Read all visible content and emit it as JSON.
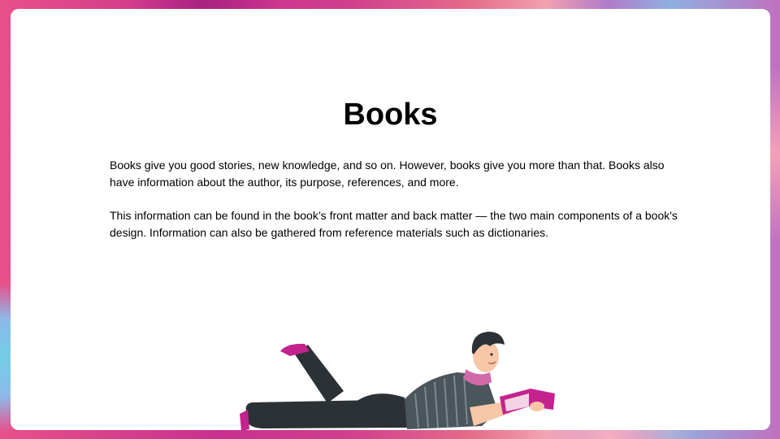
{
  "slide": {
    "title": "Books",
    "paragraphs": [
      "Books give you good stories, new knowledge, and so on. However, books give you more than that. Books also have information about the author, its purpose, references, and more.",
      "This information can be found in the book’s front matter and back matter — the two main components of a book's design. Information can also be gathered from reference materials such as dictionaries."
    ]
  },
  "colors": {
    "frame_gradient": [
      "#e8508a",
      "#c9308f",
      "#8fb0e0",
      "#6fd0e8"
    ],
    "card_background": "#ffffff",
    "text": "#000000",
    "accent_magenta": "#c4238f",
    "pants": "#2b3135",
    "shirt": "#4a555c",
    "scarf": "#d06aa8",
    "skin": "#f7c7a8"
  },
  "illustration": {
    "subject": "man-lying-reading-book"
  }
}
